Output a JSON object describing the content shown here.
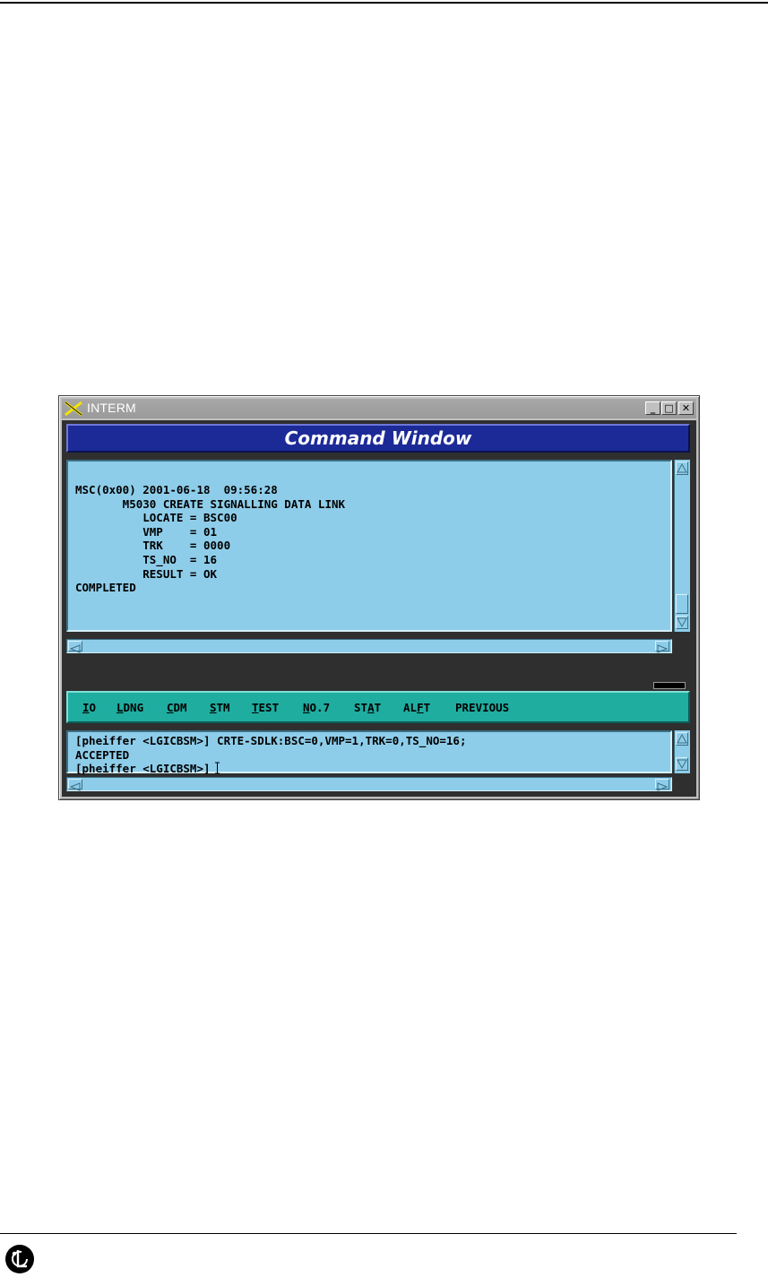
{
  "window": {
    "title": "INTERM",
    "controls": {
      "minimize": "_",
      "maximize": "□",
      "close": "✕"
    }
  },
  "command_window": {
    "header": "Command Window",
    "output_lines": [
      "MSC(0x00) 2001-06-18  09:56:28",
      "       M5030 CREATE SIGNALLING DATA LINK",
      "          LOCATE = BSC00",
      "          VMP    = 01",
      "          TRK    = 0000",
      "          TS_NO  = 16",
      "          RESULT = OK",
      "COMPLETED"
    ]
  },
  "menu": {
    "items": [
      {
        "key": "I",
        "rest": "O",
        "full": "IO"
      },
      {
        "key": "L",
        "rest": "DNG",
        "full": "LDNG"
      },
      {
        "key": "C",
        "rest": "DM",
        "full": "CDM"
      },
      {
        "key": "S",
        "rest": "TM",
        "full": "STM"
      },
      {
        "key": "T",
        "rest": "EST",
        "full": "TEST"
      },
      {
        "key": "N",
        "rest": "O.7",
        "full": "NO.7"
      },
      {
        "pre": "ST",
        "key": "A",
        "rest": "T",
        "full": "STAT"
      },
      {
        "pre": "AL",
        "key": "F",
        "rest": "T",
        "full": "ALFT"
      },
      {
        "pre": "PREVIOUS",
        "key": "",
        "rest": "",
        "full": "PREVIOUS"
      }
    ]
  },
  "input_pane": {
    "lines": [
      "[pheiffer <LGICBSM>] CRTE-SDLK:BSC=0,VMP=1,TRK=0,TS_NO=16;",
      "ACCEPTED",
      "[pheiffer <LGICBSM>]"
    ]
  },
  "colors": {
    "pane_bg": "#8ecde9",
    "header_bg": "#1c2a98",
    "menubar_bg": "#1fada0"
  }
}
